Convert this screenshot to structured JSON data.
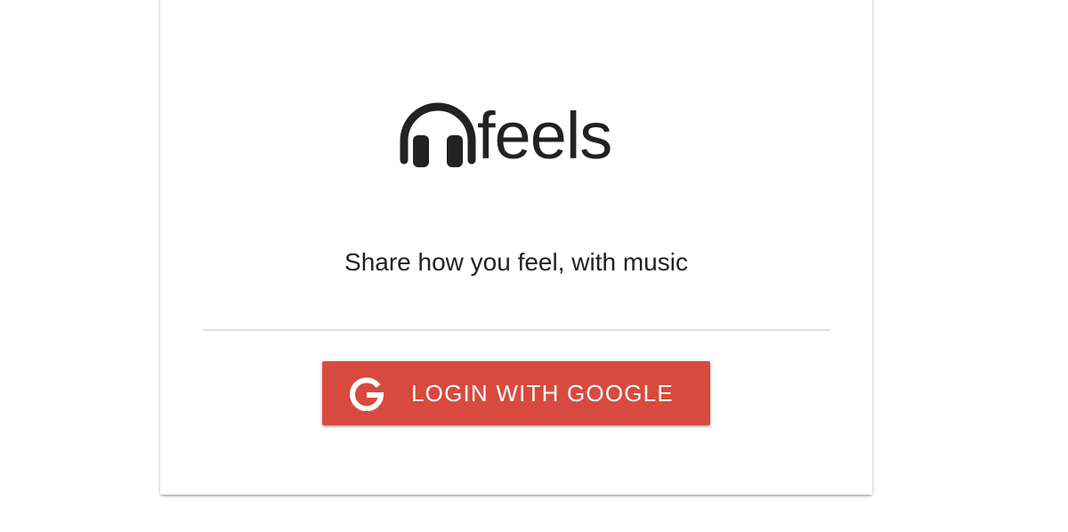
{
  "brand": {
    "name": "feels",
    "icon": "headphones-icon",
    "color": "#222222"
  },
  "tagline": "Share how you feel, with music",
  "login": {
    "label": "LOGIN WITH GOOGLE",
    "icon": "google-g-icon",
    "color": "#d84a3f",
    "text_color": "#ffffff"
  }
}
